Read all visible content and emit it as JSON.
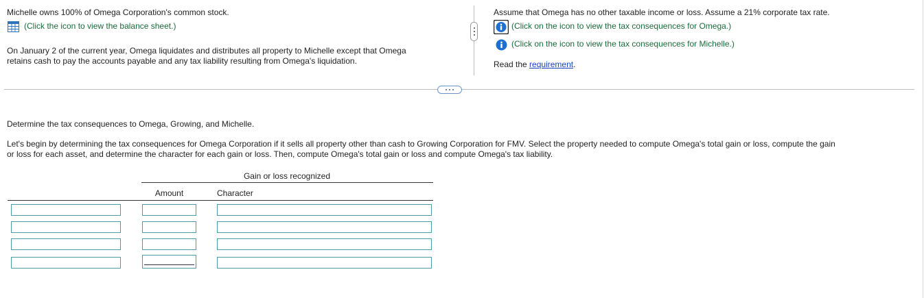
{
  "left_panel": {
    "intro": "Michelle owns 100% of Omega Corporation's common stock.",
    "balance_sheet_link": "(Click the icon to view the balance sheet.)",
    "scenario_line1": "On January 2 of the current year, Omega liquidates and distributes all property to Michelle except that Omega",
    "scenario_line2": "retains cash to pay the accounts payable and any tax liability resulting from Omega's liquidation."
  },
  "right_panel": {
    "assumption": "Assume that Omega has no other taxable income or loss. Assume a 21% corporate tax rate.",
    "omega_link": "(Click on the icon to view the tax consequences for Omega.)",
    "michelle_link": "(Click on the icon to view the tax consequences for Michelle.)",
    "read_prefix": "Read the ",
    "requirement_link": "requirement",
    "read_suffix": "."
  },
  "question": {
    "prompt": "Determine the tax consequences to Omega, Growing, and Michelle.",
    "instructions_line1": "Let's begin by determining the tax consequences for Omega Corporation if it sells all property other than cash to Growing Corporation for FMV. Select the property needed to compute Omega's total gain or loss, compute the gain",
    "instructions_line2": "or loss for each asset, and determine the character for each gain or loss. Then, compute Omega's total gain or loss and compute Omega's tax liability."
  },
  "table": {
    "group_header": "Gain or loss recognized",
    "col_amount": "Amount",
    "col_character": "Character",
    "rows": [
      {
        "property": "",
        "amount": "",
        "character": ""
      },
      {
        "property": "",
        "amount": "",
        "character": ""
      },
      {
        "property": "",
        "amount": "",
        "character": ""
      },
      {
        "property": "",
        "amount": "",
        "character": ""
      }
    ]
  },
  "colors": {
    "link_green": "#1a6b3a",
    "link_blue": "#1a3fc9",
    "info_icon_blue": "#1f6fd1",
    "field_border": "#4a9ba6"
  },
  "icons": {
    "balance_sheet": "table-grid-icon",
    "omega": "info-icon",
    "michelle": "info-icon"
  }
}
